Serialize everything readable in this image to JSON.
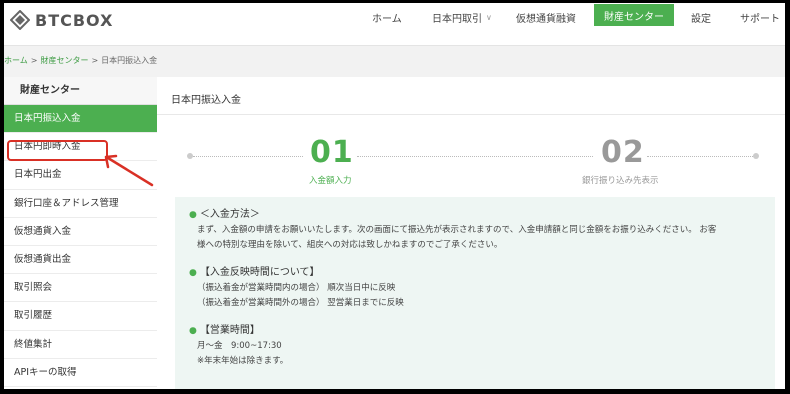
{
  "header": {
    "logo_text": "BTCBOX",
    "nav": [
      "ホーム",
      "日本円取引",
      "仮想通貨融資",
      "財産センター",
      "設定",
      "サポート"
    ],
    "active_nav": "財産センター"
  },
  "breadcrumb": [
    "ホーム",
    "財産センター",
    "日本円振込入金"
  ],
  "breadcrumb_sep": ">",
  "sidebar": {
    "title": "財産センター",
    "items": [
      "日本円振込入金",
      "日本円即時入金",
      "日本円出金",
      "銀行口座＆アドレス管理",
      "仮想通貨入金",
      "仮想通貨出金",
      "取引照会",
      "取引履歴",
      "終値集計",
      "APIキーの取得"
    ],
    "active_item": "日本円振込入金",
    "highlighted_item": "日本円即時入金"
  },
  "main": {
    "title": "日本円振込入金",
    "steps": [
      {
        "number": "01",
        "caption": "入金額入力",
        "active": true
      },
      {
        "number": "02",
        "caption": "銀行振り込み先表示",
        "active": false
      }
    ],
    "sections": [
      {
        "heading": "＜入金方法＞",
        "lines": [
          "まず、入金額の申請をお願いいたします。次の画面にて振込先が表示されますので、入金申請額と同じ金額をお振り込みください。 お客",
          "様への特別な理由を除いて、組戻への対応は致しかねますのでご了承ください。"
        ]
      },
      {
        "heading": "【入金反映時間について】",
        "lines": [
          "（振込着金が営業時間内の場合） 順次当日中に反映",
          "（振込着金が営業時間外の場合） 翌営業日までに反映"
        ]
      },
      {
        "heading": "【営業時間】",
        "lines": [
          "月～金　9:00~17:30",
          "※年末年始は除きます。"
        ]
      }
    ]
  },
  "colors": {
    "accent": "#4caf50",
    "highlight": "#d93025",
    "info_bg": "#eef6f3"
  }
}
